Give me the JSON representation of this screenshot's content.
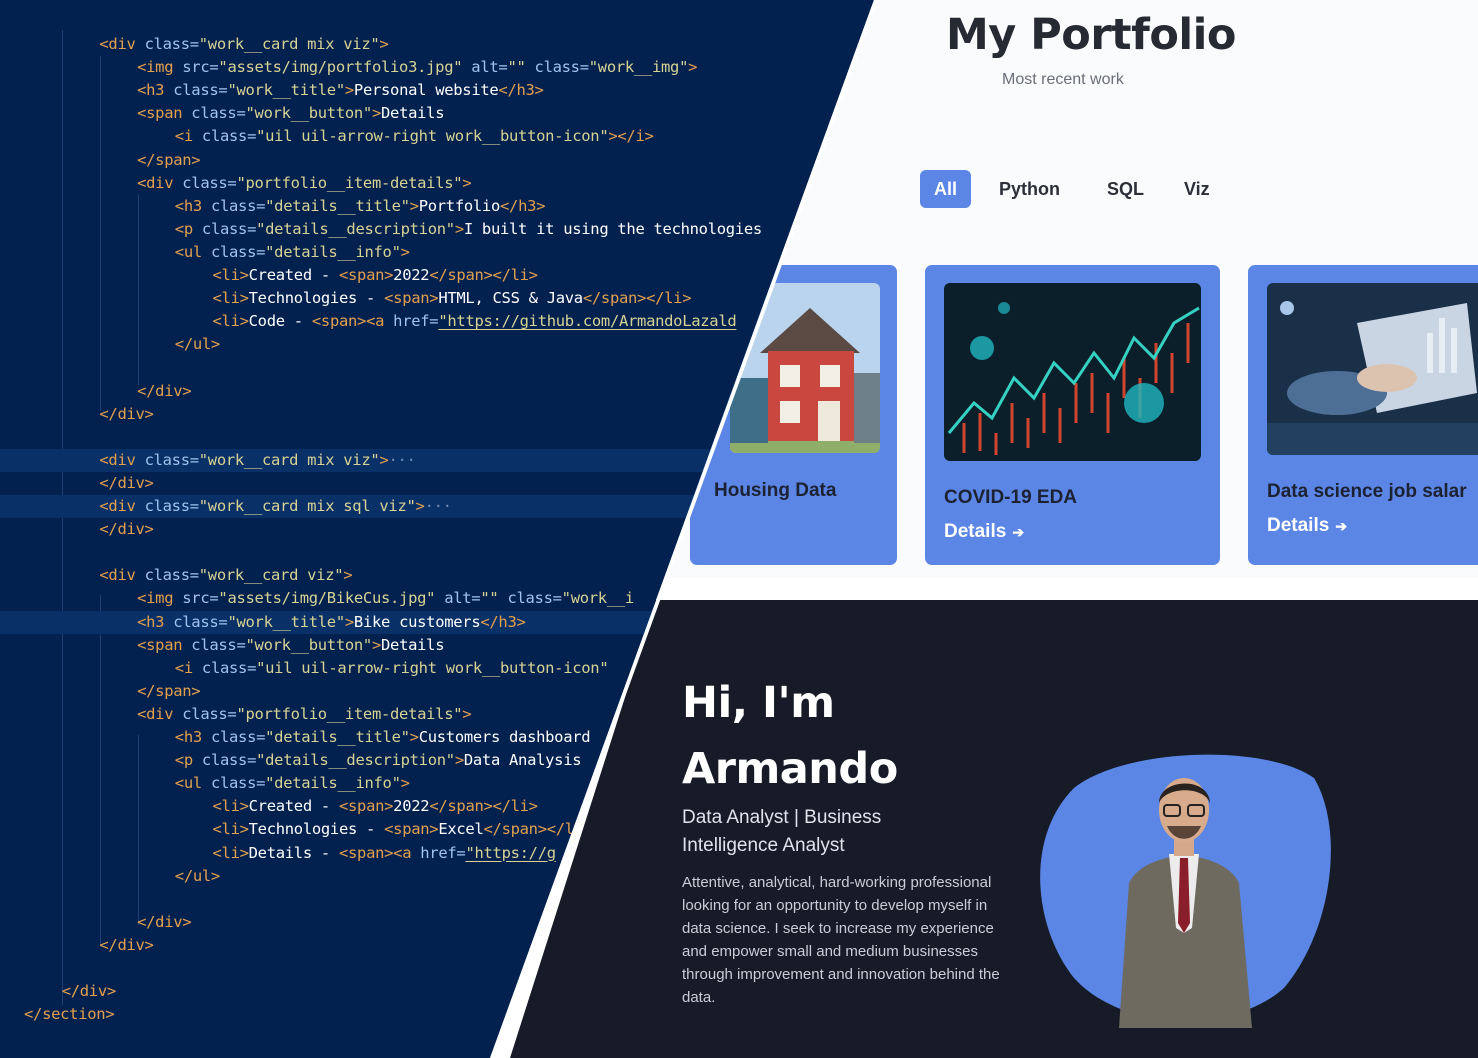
{
  "code": {
    "lines": [
      {
        "indent": 2,
        "parts": [
          [
            "tag",
            "<div "
          ],
          [
            "attr",
            "class="
          ],
          [
            "str",
            "\"work__card mix viz\""
          ],
          [
            "tag",
            ">"
          ]
        ]
      },
      {
        "indent": 3,
        "parts": [
          [
            "tag",
            "<img "
          ],
          [
            "attr",
            "src="
          ],
          [
            "str",
            "\"assets/img/portfolio3.jpg\""
          ],
          [
            "attr",
            " alt="
          ],
          [
            "str",
            "\"\""
          ],
          [
            "attr",
            " class="
          ],
          [
            "str",
            "\"work__img\""
          ],
          [
            "tag",
            ">"
          ]
        ]
      },
      {
        "indent": 3,
        "parts": [
          [
            "tag",
            "<h3 "
          ],
          [
            "attr",
            "class="
          ],
          [
            "str",
            "\"work__title\""
          ],
          [
            "tag",
            ">"
          ],
          [
            "txt",
            "Personal website"
          ],
          [
            "tag",
            "</h3>"
          ]
        ]
      },
      {
        "indent": 3,
        "parts": [
          [
            "tag",
            "<span "
          ],
          [
            "attr",
            "class="
          ],
          [
            "str",
            "\"work__button\""
          ],
          [
            "tag",
            ">"
          ],
          [
            "txt",
            "Details"
          ]
        ]
      },
      {
        "indent": 4,
        "parts": [
          [
            "tag",
            "<i "
          ],
          [
            "attr",
            "class="
          ],
          [
            "str",
            "\"uil uil-arrow-right work__button-icon\""
          ],
          [
            "tag",
            "></i>"
          ]
        ]
      },
      {
        "indent": 3,
        "parts": [
          [
            "tag",
            "</span>"
          ]
        ]
      },
      {
        "indent": 3,
        "parts": [
          [
            "tag",
            "<div "
          ],
          [
            "attr",
            "class="
          ],
          [
            "str",
            "\"portfolio__item-details\""
          ],
          [
            "tag",
            ">"
          ]
        ]
      },
      {
        "indent": 4,
        "parts": [
          [
            "tag",
            "<h3 "
          ],
          [
            "attr",
            "class="
          ],
          [
            "str",
            "\"details__title\""
          ],
          [
            "tag",
            ">"
          ],
          [
            "txt",
            "Portfolio"
          ],
          [
            "tag",
            "</h3>"
          ]
        ]
      },
      {
        "indent": 4,
        "parts": [
          [
            "tag",
            "<p "
          ],
          [
            "attr",
            "class="
          ],
          [
            "str",
            "\"details__description\""
          ],
          [
            "tag",
            ">"
          ],
          [
            "txt",
            "I built it using the technologies"
          ]
        ]
      },
      {
        "indent": 4,
        "parts": [
          [
            "tag",
            "<ul "
          ],
          [
            "attr",
            "class="
          ],
          [
            "str",
            "\"details__info\""
          ],
          [
            "tag",
            ">"
          ]
        ]
      },
      {
        "indent": 5,
        "parts": [
          [
            "tag",
            "<li>"
          ],
          [
            "txt",
            "Created - "
          ],
          [
            "tag",
            "<span>"
          ],
          [
            "txt",
            "2022"
          ],
          [
            "tag",
            "</span></li>"
          ]
        ]
      },
      {
        "indent": 5,
        "parts": [
          [
            "tag",
            "<li>"
          ],
          [
            "txt",
            "Technologies - "
          ],
          [
            "tag",
            "<span>"
          ],
          [
            "txt",
            "HTML, CSS & Java"
          ],
          [
            "tag",
            "</span></li>"
          ]
        ]
      },
      {
        "indent": 5,
        "parts": [
          [
            "tag",
            "<li>"
          ],
          [
            "txt",
            "Code - "
          ],
          [
            "tag",
            "<span><a "
          ],
          [
            "attr",
            "href="
          ],
          [
            "str u",
            "\"https://github.com/ArmandoLazald"
          ]
        ]
      },
      {
        "indent": 4,
        "parts": [
          [
            "tag",
            "</ul>"
          ]
        ]
      },
      {
        "indent": 0,
        "parts": []
      },
      {
        "indent": 3,
        "parts": [
          [
            "tag",
            "</div>"
          ]
        ]
      },
      {
        "indent": 2,
        "parts": [
          [
            "tag",
            "</div>"
          ]
        ]
      },
      {
        "indent": 0,
        "parts": []
      },
      {
        "indent": 2,
        "hl": true,
        "parts": [
          [
            "tag",
            "<div "
          ],
          [
            "attr",
            "class="
          ],
          [
            "str",
            "\"work__card mix viz\""
          ],
          [
            "tag",
            ">"
          ],
          [
            "fold",
            "···"
          ]
        ]
      },
      {
        "indent": 2,
        "parts": [
          [
            "tag",
            "</div>"
          ]
        ]
      },
      {
        "indent": 2,
        "hl": true,
        "parts": [
          [
            "tag",
            "<div "
          ],
          [
            "attr",
            "class="
          ],
          [
            "str",
            "\"work__card mix sql viz\""
          ],
          [
            "tag",
            ">"
          ],
          [
            "fold",
            "···"
          ]
        ]
      },
      {
        "indent": 2,
        "parts": [
          [
            "tag",
            "</div>"
          ]
        ]
      },
      {
        "indent": 0,
        "parts": []
      },
      {
        "indent": 2,
        "parts": [
          [
            "tag",
            "<div "
          ],
          [
            "attr",
            "class="
          ],
          [
            "str",
            "\"work__card viz\""
          ],
          [
            "tag",
            ">"
          ]
        ]
      },
      {
        "indent": 3,
        "parts": [
          [
            "tag",
            "<img "
          ],
          [
            "attr",
            "src="
          ],
          [
            "str",
            "\"assets/img/BikeCus.jpg\""
          ],
          [
            "attr",
            " alt="
          ],
          [
            "str",
            "\"\""
          ],
          [
            "attr",
            " class="
          ],
          [
            "str",
            "\"work__i"
          ]
        ]
      },
      {
        "indent": 3,
        "hl": true,
        "parts": [
          [
            "tag",
            "<h3 "
          ],
          [
            "attr",
            "class="
          ],
          [
            "str",
            "\"work__title\""
          ],
          [
            "tag",
            ">"
          ],
          [
            "txt",
            "Bike customers"
          ],
          [
            "tag",
            "</h3>"
          ]
        ]
      },
      {
        "indent": 3,
        "parts": [
          [
            "tag",
            "<span "
          ],
          [
            "attr",
            "class="
          ],
          [
            "str",
            "\"work__button\""
          ],
          [
            "tag",
            ">"
          ],
          [
            "txt",
            "Details"
          ]
        ]
      },
      {
        "indent": 4,
        "parts": [
          [
            "tag",
            "<i "
          ],
          [
            "attr",
            "class="
          ],
          [
            "str",
            "\"uil uil-arrow-right work__button-icon\""
          ]
        ]
      },
      {
        "indent": 3,
        "parts": [
          [
            "tag",
            "</span>"
          ]
        ]
      },
      {
        "indent": 3,
        "parts": [
          [
            "tag",
            "<div "
          ],
          [
            "attr",
            "class="
          ],
          [
            "str",
            "\"portfolio__item-details\""
          ],
          [
            "tag",
            ">"
          ]
        ]
      },
      {
        "indent": 4,
        "parts": [
          [
            "tag",
            "<h3 "
          ],
          [
            "attr",
            "class="
          ],
          [
            "str",
            "\"details__title\""
          ],
          [
            "tag",
            ">"
          ],
          [
            "txt",
            "Customers dashboard"
          ]
        ]
      },
      {
        "indent": 4,
        "parts": [
          [
            "tag",
            "<p "
          ],
          [
            "attr",
            "class="
          ],
          [
            "str",
            "\"details__description\""
          ],
          [
            "tag",
            ">"
          ],
          [
            "txt",
            "Data Analysis"
          ]
        ]
      },
      {
        "indent": 4,
        "parts": [
          [
            "tag",
            "<ul "
          ],
          [
            "attr",
            "class="
          ],
          [
            "str",
            "\"details__info\""
          ],
          [
            "tag",
            ">"
          ]
        ]
      },
      {
        "indent": 5,
        "parts": [
          [
            "tag",
            "<li>"
          ],
          [
            "txt",
            "Created - "
          ],
          [
            "tag",
            "<span>"
          ],
          [
            "txt",
            "2022"
          ],
          [
            "tag",
            "</span></li>"
          ]
        ]
      },
      {
        "indent": 5,
        "parts": [
          [
            "tag",
            "<li>"
          ],
          [
            "txt",
            "Technologies - "
          ],
          [
            "tag",
            "<span>"
          ],
          [
            "txt",
            "Excel"
          ],
          [
            "tag",
            "</span></li>"
          ]
        ]
      },
      {
        "indent": 5,
        "parts": [
          [
            "tag",
            "<li>"
          ],
          [
            "txt",
            "Details - "
          ],
          [
            "tag",
            "<span><a "
          ],
          [
            "attr",
            "href="
          ],
          [
            "str u",
            "\"https://g"
          ]
        ]
      },
      {
        "indent": 4,
        "parts": [
          [
            "tag",
            "</ul>"
          ]
        ]
      },
      {
        "indent": 0,
        "parts": []
      },
      {
        "indent": 3,
        "parts": [
          [
            "tag",
            "</div>"
          ]
        ]
      },
      {
        "indent": 2,
        "parts": [
          [
            "tag",
            "</div>"
          ]
        ]
      },
      {
        "indent": 0,
        "parts": []
      },
      {
        "indent": 1,
        "parts": [
          [
            "tag",
            "</div>"
          ]
        ]
      },
      {
        "indent": 0,
        "parts": [
          [
            "tag",
            "</section>"
          ]
        ]
      }
    ],
    "brace_text": "{}"
  },
  "portfolio": {
    "title": "My Portfolio",
    "subtitle": "Most recent work",
    "filters": [
      {
        "label": "All",
        "active": true
      },
      {
        "label": "Python",
        "active": false
      },
      {
        "label": "SQL",
        "active": false
      },
      {
        "label": "Viz",
        "active": false
      }
    ],
    "cards": [
      {
        "title": "Housing Data",
        "details": "",
        "image": "house-image"
      },
      {
        "title": "COVID-19 EDA",
        "details": "Details",
        "image": "covid-chart-image"
      },
      {
        "title": "Data science job salar",
        "details": "Details",
        "image": "laptop-data-image"
      }
    ]
  },
  "hero": {
    "greeting": "Hi, I'm",
    "name": "Armando",
    "role": "Data Analyst | Business Intelligence Analyst",
    "description": "Attentive, analytical, hard-working professional looking for an opportunity to develop myself in data science. I seek to increase my experience and empower small and medium businesses through improvement and innovation behind the data.",
    "accent": "#5b86e5",
    "photo": "profile-photo"
  }
}
